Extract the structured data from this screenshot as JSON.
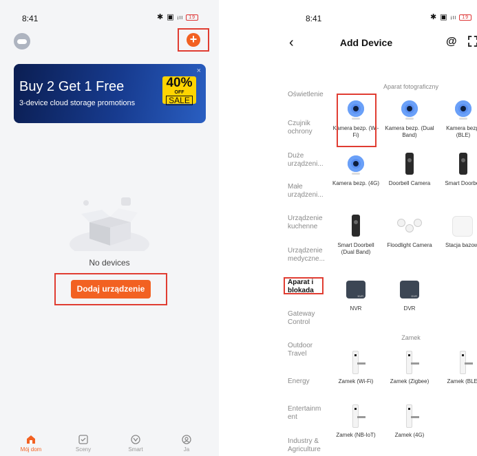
{
  "left": {
    "status": {
      "time": "8:41",
      "icons": "✱ ▣ ᵢₗₗ",
      "battery": "19"
    },
    "banner": {
      "title": "Buy 2 Get 1 Free",
      "subtitle": "3-device cloud storage promotions",
      "percent": "40%",
      "off": "OFF",
      "sale": "SALE",
      "close": "×"
    },
    "empty_text": "No devices",
    "add_button": "Dodaj urządzenie",
    "tabs": [
      {
        "label": "Mój dom",
        "icon": "home-icon"
      },
      {
        "label": "Sceny",
        "icon": "checkbox-icon"
      },
      {
        "label": "Smart",
        "icon": "smart-icon"
      },
      {
        "label": "Ja",
        "icon": "profile-icon"
      }
    ]
  },
  "right": {
    "status": {
      "time": "8:41",
      "icons": "✱ ▣ ᵢₗₗ",
      "battery": "19"
    },
    "title": "Add Device",
    "categories": [
      "Oświetlenie",
      "Czujnik ochrony",
      "Duże urządzeni...",
      "Małe urządzeni...",
      "Urządzenie kuchenne",
      "Urządzenie medyczne...",
      "Aparat i blokada",
      "Gateway Control",
      "Outdoor Travel",
      "Energy",
      "Entertainm ent",
      "Industry & Agriculture"
    ],
    "sections": [
      "Aparat fotograficzny",
      "Zamek"
    ],
    "devices": [
      "Kamera bezp. (Wi-Fi)",
      "Kamera bezp. (Dual Band)",
      "Kamera bezp. (BLE)",
      "Kamera bezp. (4G)",
      "Doorbell Camera",
      "Smart Doorbell",
      "Smart Doorbell (Dual Band)",
      "Floodlight Camera",
      "Stacja bazowa",
      "NVR",
      "DVR",
      "Zamek (Wi-Fi)",
      "Zamek (Zigbee)",
      "Zamek (BLE)",
      "Zamek (NB-IoT)",
      "Zamek (4G)"
    ],
    "nvr_badge": "NVR",
    "dvr_badge": "DVR"
  }
}
